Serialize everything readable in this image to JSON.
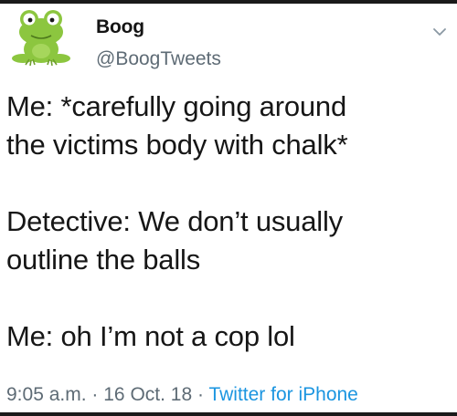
{
  "tweet": {
    "author": {
      "display_name": "Boog",
      "handle": "@BoogTweets",
      "avatar_icon": "frog-avatar-icon"
    },
    "menu_icon": "chevron-down-icon",
    "paragraphs": [
      "Me: *carefully going around\nthe victims body with chalk*",
      "Detective: We don’t usually\noutline the balls",
      "Me: oh I’m not a cop lol"
    ],
    "time": "9:05 a.m.",
    "separator": "·",
    "date": "16 Oct. 18",
    "source": "Twitter for iPhone"
  },
  "colors": {
    "avatar_green": "#8cc63f",
    "link_blue": "#1b95e0",
    "meta_gray": "#5e6b75"
  }
}
